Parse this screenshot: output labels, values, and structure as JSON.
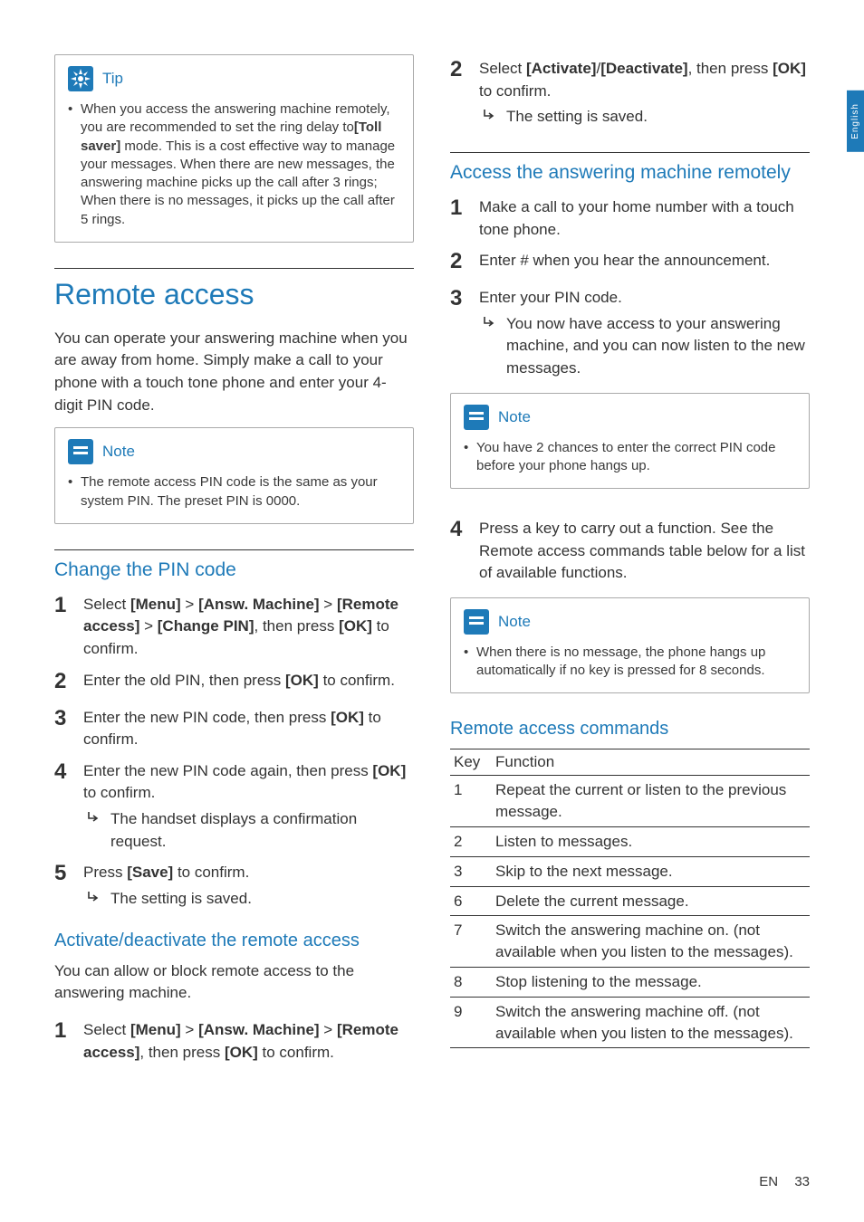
{
  "lang_tab": "English",
  "footer": {
    "lang": "EN",
    "page": "33"
  },
  "left": {
    "tip": {
      "label": "Tip",
      "body_parts": [
        "When you access the answering machine remotely, you are recommended to set the ring delay to",
        "[Toll saver]",
        " mode. This is a cost effective way to manage your messages. When there are new messages, the answering machine picks up the call after 3 rings; When there is no messages, it picks up the call after 5 rings."
      ]
    },
    "h1": "Remote access",
    "intro": "You can operate your answering machine when you are away from home. Simply make a call to your phone with a touch tone phone and enter your 4-digit PIN code.",
    "note1": {
      "label": "Note",
      "body": "The remote access PIN code is the same as your system PIN. The preset PIN is 0000."
    },
    "h2a": "Change the PIN code",
    "steps_a": [
      {
        "n": "1",
        "parts": [
          "Select ",
          "[Menu]",
          " > ",
          "[Answ. Machine]",
          " > ",
          "[Remote access]",
          " > ",
          "[Change PIN]",
          ", then press ",
          "[OK]",
          " to confirm."
        ]
      },
      {
        "n": "2",
        "parts": [
          "Enter the old PIN, then press ",
          "[OK]",
          " to confirm."
        ]
      },
      {
        "n": "3",
        "parts": [
          "Enter the new PIN code, then press ",
          "[OK]",
          " to confirm."
        ]
      },
      {
        "n": "4",
        "parts": [
          "Enter the new PIN code again, then press ",
          "[OK]",
          " to confirm."
        ],
        "result": "The handset displays a confirmation request."
      },
      {
        "n": "5",
        "parts": [
          "Press ",
          "[Save]",
          " to confirm."
        ],
        "result": "The setting is saved."
      }
    ],
    "h2b": "Activate/deactivate the remote access",
    "p_b": "You can allow or block remote access to the answering machine.",
    "steps_b": [
      {
        "n": "1",
        "parts": [
          "Select ",
          "[Menu]",
          " > ",
          "[Answ. Machine]",
          " > ",
          "[Remote access]",
          ", then press ",
          "[OK]",
          " to confirm."
        ]
      }
    ]
  },
  "right": {
    "steps_c": [
      {
        "n": "2",
        "parts": [
          "Select ",
          "[Activate]",
          "/",
          "[Deactivate]",
          ", then press ",
          "[OK]",
          " to confirm."
        ],
        "result": "The setting is saved."
      }
    ],
    "h2a": "Access the answering machine remotely",
    "steps_d": [
      {
        "n": "1",
        "parts": [
          "Make a call to your home number with a touch tone phone."
        ]
      },
      {
        "n": "2",
        "parts": [
          "Enter # when you hear the announcement."
        ]
      },
      {
        "n": "3",
        "parts": [
          "Enter your PIN code."
        ],
        "result": "You now have access to your answering machine, and you can now listen to the new messages."
      }
    ],
    "note2": {
      "label": "Note",
      "body": "You have 2 chances to enter the correct PIN code before your phone hangs up."
    },
    "steps_e": [
      {
        "n": "4",
        "parts": [
          "Press a key to carry out a function. See the Remote access commands table below for a list of available functions."
        ]
      }
    ],
    "note3": {
      "label": "Note",
      "body": "When there is no message, the phone hangs up automatically if no key is pressed for 8 seconds."
    },
    "h3": "Remote access commands",
    "table": {
      "head": [
        "Key",
        "Function"
      ],
      "rows": [
        [
          "1",
          "Repeat the current or listen to the previous message."
        ],
        [
          "2",
          "Listen to messages."
        ],
        [
          "3",
          "Skip to the next message."
        ],
        [
          "6",
          "Delete the current message."
        ],
        [
          "7",
          "Switch the answering machine on. (not available when you listen to the messages)."
        ],
        [
          "8",
          "Stop listening to the message."
        ],
        [
          "9",
          "Switch the answering machine off. (not available when you listen to the messages)."
        ]
      ]
    }
  }
}
